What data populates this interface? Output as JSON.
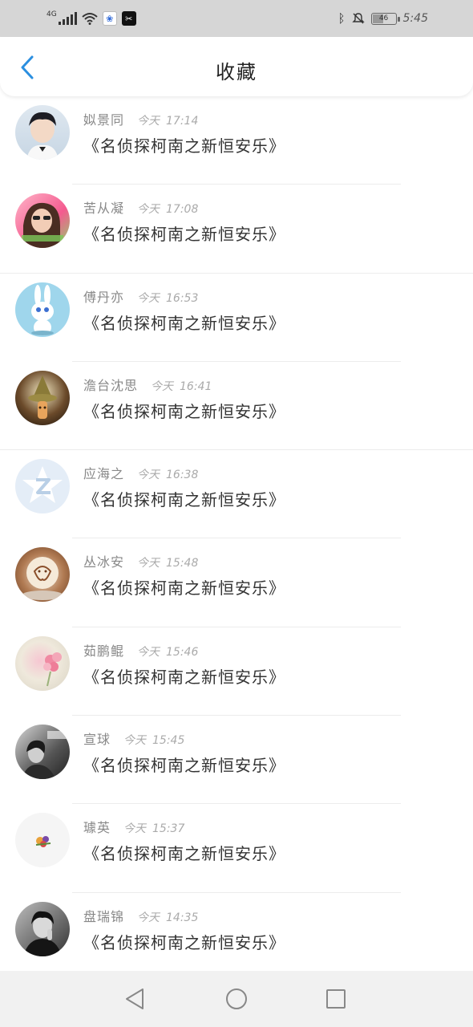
{
  "status_bar": {
    "network": "4G",
    "time": "5:45",
    "battery": "46",
    "battery_level": 0.46,
    "icons": [
      "signal-icon",
      "wifi-icon",
      "baidu-app-icon",
      "capcut-app-icon",
      "bluetooth-icon",
      "mute-icon",
      "battery-icon"
    ]
  },
  "header": {
    "title": "收藏",
    "back_icon": "chevron-left-icon",
    "accent_color": "#2b8fe0"
  },
  "favorites": [
    {
      "user": "姒景同",
      "day": "今天",
      "time": "17:14",
      "content": "《名侦探柯南之新恒安乐》"
    },
    {
      "user": "苦从凝",
      "day": "今天",
      "time": "17:08",
      "content": "《名侦探柯南之新恒安乐》"
    },
    {
      "user": "傅丹亦",
      "day": "今天",
      "time": "16:53",
      "content": "《名侦探柯南之新恒安乐》"
    },
    {
      "user": "澹台沈思",
      "day": "今天",
      "time": "16:41",
      "content": "《名侦探柯南之新恒安乐》"
    },
    {
      "user": "应海之",
      "day": "今天",
      "time": "16:38",
      "content": "《名侦探柯南之新恒安乐》"
    },
    {
      "user": "丛冰安",
      "day": "今天",
      "time": "15:48",
      "content": "《名侦探柯南之新恒安乐》"
    },
    {
      "user": "茹鹏鲲",
      "day": "今天",
      "time": "15:46",
      "content": "《名侦探柯南之新恒安乐》"
    },
    {
      "user": "宣球",
      "day": "今天",
      "time": "15:45",
      "content": "《名侦探柯南之新恒安乐》"
    },
    {
      "user": "璩英",
      "day": "今天",
      "time": "15:37",
      "content": "《名侦探柯南之新恒安乐》"
    },
    {
      "user": "盘瑞锦",
      "day": "今天",
      "time": "14:35",
      "content": "《名侦探柯南之新恒安乐》"
    }
  ],
  "nav_bar": {
    "icons": [
      "back-triangle-icon",
      "home-circle-icon",
      "recents-square-icon"
    ]
  }
}
